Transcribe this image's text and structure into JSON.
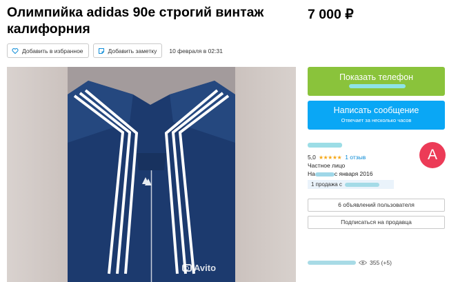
{
  "listing": {
    "title": "Олимпийка adidas 90е строгий винтаж калифорния",
    "price": "7 000 ₽"
  },
  "actions": {
    "favorite_label": "Добавить в избранное",
    "note_label": "Добавить заметку",
    "date": "10 февраля в 02:31",
    "favorite_icon": "heart-icon",
    "note_icon": "note-icon"
  },
  "photo": {
    "watermark": "Avito",
    "watermark_icon": "camera-icon"
  },
  "contact": {
    "phone_label": "Показать телефон",
    "message_label": "Написать сообщение",
    "message_sub": "Отвечает за несколько часов",
    "phone_color": "#8ac33b",
    "message_color": "#0aa7f5"
  },
  "seller": {
    "rating": "5,0",
    "stars": "★★★★★",
    "reviews": "1 отзыв",
    "type": "Частное лицо",
    "since_prefix": "На",
    "since_suffix": "с января 2016",
    "sales_prefix": "1 продажа с",
    "avatar_letter": "A",
    "avatar_color": "#ec3b57",
    "ads_label": "6 объявлений пользователя",
    "subscribe_label": "Подписаться на продавца"
  },
  "stats": {
    "views": "355 (+5)",
    "views_icon": "eye-icon"
  }
}
